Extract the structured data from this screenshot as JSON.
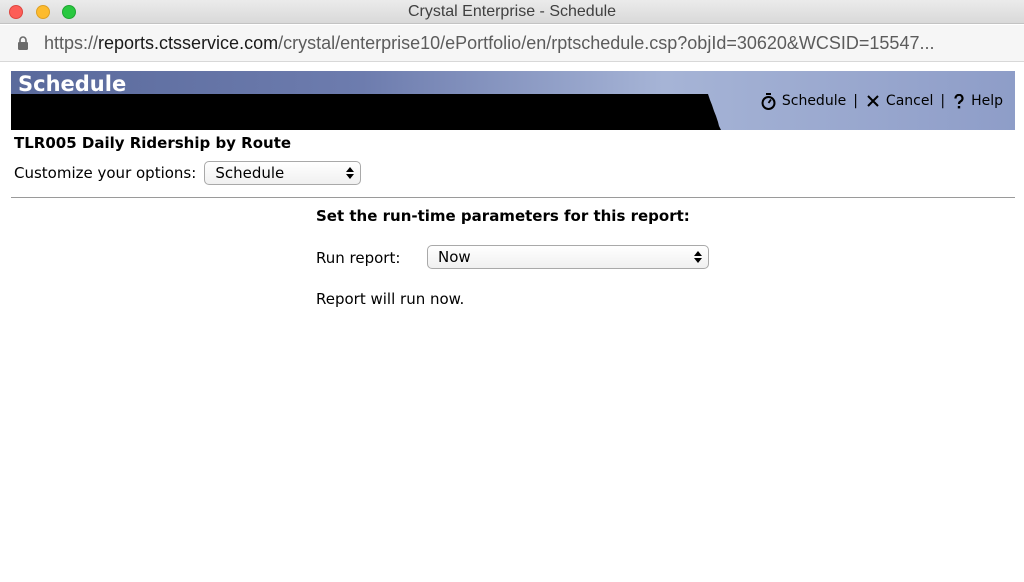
{
  "window": {
    "title": "Crystal Enterprise - Schedule"
  },
  "address_bar": {
    "scheme": "https://",
    "host": "reports.ctsservice.com",
    "path": "/crystal/enterprise10/ePortfolio/en/rptschedule.csp?objId=30620&WCSID=15547..."
  },
  "banner": {
    "title": "Schedule",
    "actions": {
      "schedule_label": "Schedule",
      "cancel_label": "Cancel",
      "help_label": "Help",
      "separator": "|"
    },
    "icons": [
      "stopwatch-icon",
      "x-icon",
      "question-icon"
    ],
    "colors": {
      "text": "#ffffff",
      "band": "#000000"
    }
  },
  "report": {
    "title": "TLR005 Daily Ridership by Route"
  },
  "customize": {
    "label": "Customize your options:",
    "selected": "Schedule"
  },
  "params": {
    "heading": "Set the run-time parameters for this report:",
    "run_label": "Run report:",
    "run_selected": "Now",
    "status_text": "Report will run now."
  }
}
